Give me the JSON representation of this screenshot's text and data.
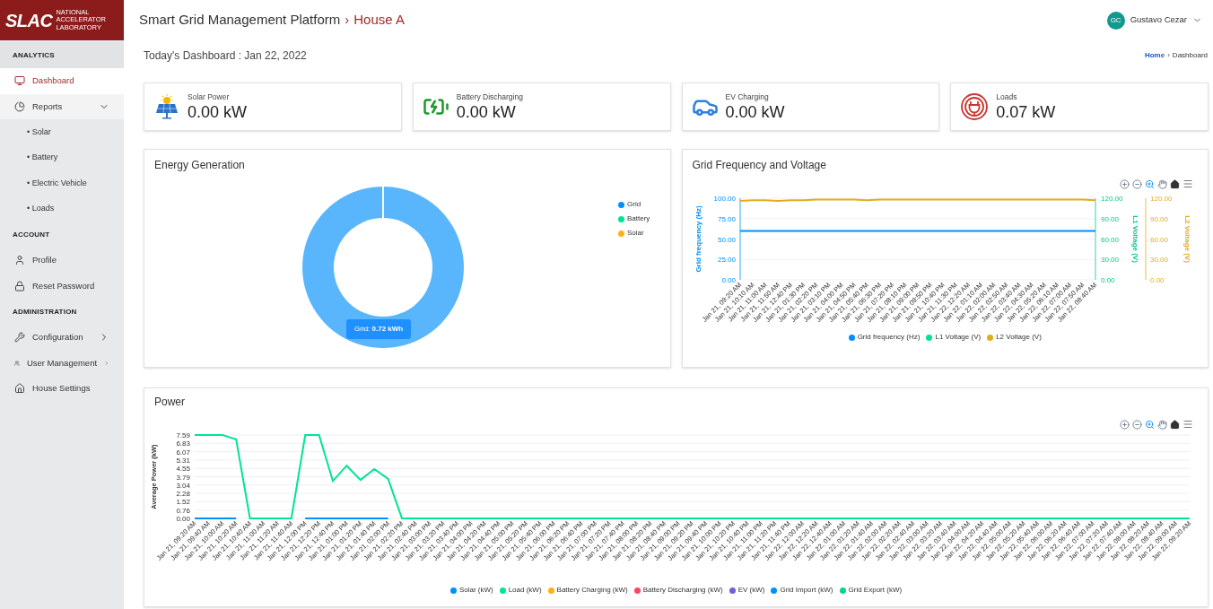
{
  "sidebar": {
    "logo": {
      "text": "SLAC",
      "lines": [
        "NATIONAL",
        "ACCELERATOR",
        "LABORATORY"
      ]
    },
    "sections": [
      {
        "title": "ANALYTICS",
        "items": [
          {
            "label": "Dashboard",
            "selected": true
          },
          {
            "label": "Reports",
            "selected": false,
            "expanded": true,
            "children": [
              {
                "label": "• Solar",
                "selected": false
              },
              {
                "label": "• Battery",
                "selected": false
              },
              {
                "label": "• Electric Vehicle",
                "selected": false
              },
              {
                "label": "• Loads",
                "selected": false
              }
            ]
          }
        ]
      },
      {
        "title": "ACCOUNT",
        "items": [
          {
            "label": "Profile",
            "selected": false
          },
          {
            "label": "Reset Password",
            "selected": false
          }
        ]
      },
      {
        "title": "ADMINISTRATION",
        "items": [
          {
            "label": "Configuration",
            "selected": false,
            "expanded": false
          },
          {
            "label": "User Management",
            "selected": false,
            "expanded": false
          },
          {
            "label": "House Settings",
            "selected": false
          }
        ]
      }
    ]
  },
  "header": {
    "title": "Smart Grid Management Platform",
    "separator": "›",
    "page": "House A",
    "user": {
      "initials": "GC",
      "name": "Gustavo Cezar"
    }
  },
  "subheader": {
    "title": "Today's Dashboard : Jan 22, 2022",
    "breadcrumb": [
      "Home",
      "›",
      "Dashboard"
    ]
  },
  "stats": [
    {
      "kind": "solar",
      "label": "Solar Power",
      "value": "0.00 kW"
    },
    {
      "kind": "battery",
      "label": "Battery Discharging",
      "value": "0.00 kW"
    },
    {
      "kind": "ev",
      "label": "EV Charging",
      "value": "0.00 kW"
    },
    {
      "kind": "loads",
      "label": "Loads",
      "value": "0.07 kW"
    }
  ],
  "energy_generation": {
    "title": "Energy Generation",
    "tooltip": "Grid:  **0.72 kWh**",
    "chart_data": {
      "type": "donut",
      "categories": [
        "Grid",
        "Battery",
        "Solar"
      ],
      "values": [
        100,
        0,
        0
      ],
      "colors": [
        "#008ffb",
        "#00e396",
        "#feb019"
      ]
    }
  },
  "grid_frequency": {
    "title": "Grid Frequency and Voltage",
    "chart_data": {
      "type": "line",
      "grid": true,
      "categories": [
        "Jan 21, 09:20 AM",
        "Jan 21, 10:10 AM",
        "Jan 21, 11:00 AM",
        "Jan 21, 11:50 AM",
        "Jan 21, 12:40 PM",
        "Jan 21, 01:30 PM",
        "Jan 21, 02:20 PM",
        "Jan 21, 03:10 PM",
        "Jan 21, 04:00 PM",
        "Jan 21, 04:50 PM",
        "Jan 21, 05:40 PM",
        "Jan 21, 06:30 PM",
        "Jan 21, 07:20 PM",
        "Jan 21, 08:10 PM",
        "Jan 21, 09:00 PM",
        "Jan 21, 09:50 PM",
        "Jan 21, 10:40 PM",
        "Jan 21, 11:30 PM",
        "Jan 22, 12:20 AM",
        "Jan 22, 01:10 AM",
        "Jan 22, 02:00 AM",
        "Jan 22, 02:50 AM",
        "Jan 22, 03:40 AM",
        "Jan 22, 04:30 AM",
        "Jan 22, 05:20 AM",
        "Jan 22, 06:10 AM",
        "Jan 22, 07:00 AM",
        "Jan 22, 07:50 AM",
        "Jan 22, 08:40 AM"
      ],
      "ylabel": "Grid frequency (Hz)",
      "ylim": [
        0,
        100
      ],
      "yticks": [
        {
          "value": 0,
          "label": "0.00"
        },
        {
          "value": 25,
          "label": "25.00"
        },
        {
          "value": 50,
          "label": "50.00"
        },
        {
          "value": 75,
          "label": "75.00"
        },
        {
          "value": 100,
          "label": "100.00"
        }
      ],
      "y2label": "L1 Voltage (V)",
      "y2lim": [
        0,
        120
      ],
      "y2ticks": [
        {
          "value": 0,
          "label": "0.00"
        },
        {
          "value": 30,
          "label": "30.00"
        },
        {
          "value": 60,
          "label": "60.00"
        },
        {
          "value": 90,
          "label": "90.00"
        },
        {
          "value": 120,
          "label": "120.00"
        }
      ],
      "y3label": "L2 Voltage (V)",
      "y3lim": [
        0,
        120
      ],
      "y3ticks": [
        {
          "value": 0,
          "label": "0.00"
        },
        {
          "value": 30,
          "label": "30.00"
        },
        {
          "value": 60,
          "label": "60.00"
        },
        {
          "value": 90,
          "label": "90.00"
        },
        {
          "value": 120,
          "label": "120.00"
        }
      ],
      "series": [
        {
          "name": "Grid frequency (Hz)",
          "color": "#008ffb",
          "axis": "y",
          "values": [
            60,
            60,
            60,
            60,
            60,
            60,
            60,
            60,
            60,
            60,
            60,
            60,
            60,
            60,
            60,
            60,
            60,
            60,
            60,
            60,
            60,
            60,
            60,
            60,
            60,
            60,
            60,
            60,
            60
          ]
        },
        {
          "name": "L1 Voltage (V)",
          "color": "#00e396",
          "axis": "y2",
          "values": [
            null,
            null,
            null,
            null,
            null,
            null,
            null,
            null,
            null,
            null,
            null,
            null,
            null,
            null,
            null,
            null,
            null,
            null,
            null,
            null,
            null,
            null,
            null,
            null,
            null,
            null,
            null,
            null,
            null
          ]
        },
        {
          "name": "L2 Voltage (V)",
          "color": "#e2ac1c",
          "axis": "y3",
          "values": [
            116,
            117,
            117,
            116,
            117,
            117,
            118,
            118,
            118,
            118,
            117,
            118,
            118,
            118,
            118,
            118,
            118,
            118,
            118,
            118,
            118,
            118,
            118,
            118,
            118,
            118,
            118,
            118,
            117
          ]
        }
      ]
    }
  },
  "power": {
    "title": "Power",
    "chart_data": {
      "type": "line",
      "grid": true,
      "ylabel": "Average Power (kW)",
      "ylim": [
        0,
        7.59
      ],
      "yticks": [
        {
          "value": 0,
          "label": "0.00"
        },
        {
          "value": 0.76,
          "label": "0.76"
        },
        {
          "value": 1.52,
          "label": "1.52"
        },
        {
          "value": 2.28,
          "label": "2.28"
        },
        {
          "value": 3.04,
          "label": "3.04"
        },
        {
          "value": 3.79,
          "label": "3.79"
        },
        {
          "value": 4.55,
          "label": "4.55"
        },
        {
          "value": 5.31,
          "label": "5.31"
        },
        {
          "value": 6.07,
          "label": "6.07"
        },
        {
          "value": 6.83,
          "label": "6.83"
        },
        {
          "value": 7.59,
          "label": "7.59"
        }
      ],
      "categories": [
        "Jan 21, 09:20 AM",
        "Jan 21, 09:40 AM",
        "Jan 21, 10:00 AM",
        "Jan 21, 10:20 AM",
        "Jan 21, 10:40 AM",
        "Jan 21, 11:00 AM",
        "Jan 21, 11:20 AM",
        "Jan 21, 11:40 AM",
        "Jan 21, 12:00 PM",
        "Jan 21, 12:20 PM",
        "Jan 21, 12:40 PM",
        "Jan 21, 01:00 PM",
        "Jan 21, 01:20 PM",
        "Jan 21, 01:40 PM",
        "Jan 21, 02:00 PM",
        "Jan 21, 02:20 PM",
        "Jan 21, 02:40 PM",
        "Jan 21, 03:00 PM",
        "Jan 21, 03:20 PM",
        "Jan 21, 03:40 PM",
        "Jan 21, 04:00 PM",
        "Jan 21, 04:20 PM",
        "Jan 21, 04:40 PM",
        "Jan 21, 05:00 PM",
        "Jan 21, 05:20 PM",
        "Jan 21, 05:40 PM",
        "Jan 21, 06:00 PM",
        "Jan 21, 06:20 PM",
        "Jan 21, 06:40 PM",
        "Jan 21, 07:00 PM",
        "Jan 21, 07:20 PM",
        "Jan 21, 07:40 PM",
        "Jan 21, 08:00 PM",
        "Jan 21, 08:20 PM",
        "Jan 21, 08:40 PM",
        "Jan 21, 09:00 PM",
        "Jan 21, 09:20 PM",
        "Jan 21, 09:40 PM",
        "Jan 21, 10:00 PM",
        "Jan 21, 10:20 PM",
        "Jan 21, 10:40 PM",
        "Jan 21, 11:00 PM",
        "Jan 21, 11:20 PM",
        "Jan 21, 11:40 PM",
        "Jan 22, 12:00 AM",
        "Jan 22, 12:20 AM",
        "Jan 22, 12:40 AM",
        "Jan 22, 01:00 AM",
        "Jan 22, 01:20 AM",
        "Jan 22, 01:40 AM",
        "Jan 22, 02:00 AM",
        "Jan 22, 02:20 AM",
        "Jan 22, 02:40 AM",
        "Jan 22, 03:00 AM",
        "Jan 22, 03:20 AM",
        "Jan 22, 03:40 AM",
        "Jan 22, 04:00 AM",
        "Jan 22, 04:20 AM",
        "Jan 22, 04:40 AM",
        "Jan 22, 05:00 AM",
        "Jan 22, 05:20 AM",
        "Jan 22, 05:40 AM",
        "Jan 22, 06:00 AM",
        "Jan 22, 06:20 AM",
        "Jan 22, 06:40 AM",
        "Jan 22, 07:00 AM",
        "Jan 22, 07:20 AM",
        "Jan 22, 07:40 AM",
        "Jan 22, 08:00 AM",
        "Jan 22, 08:20 AM",
        "Jan 22, 08:40 AM",
        "Jan 22, 09:00 AM",
        "Jan 22, 09:20 AM"
      ],
      "series": [
        {
          "name": "Solar (kW)",
          "color": "#008ffb",
          "values": [
            0,
            0,
            0,
            0,
            null,
            null,
            null,
            null,
            0,
            0,
            0,
            0,
            0,
            0,
            0,
            null,
            null,
            null,
            null,
            null,
            null,
            null,
            null,
            null,
            null,
            null,
            null,
            null,
            null,
            null,
            null,
            null,
            null,
            null,
            null,
            null,
            null,
            null,
            null,
            null,
            null,
            null,
            null,
            null,
            null,
            null,
            null,
            null,
            null,
            null,
            null,
            null,
            null,
            null,
            null,
            null,
            null,
            null,
            null,
            null,
            null,
            null,
            null,
            null,
            null,
            null,
            null,
            null,
            null,
            null,
            null,
            null,
            null
          ]
        },
        {
          "name": "Load (kW)",
          "color": "#00e396",
          "values": [
            7.59,
            7.59,
            7.59,
            7.2,
            0,
            0,
            0,
            0,
            7.59,
            7.59,
            3.4,
            4.8,
            3.5,
            4.5,
            3.6,
            0,
            0,
            0,
            0,
            0,
            0,
            0,
            0,
            0,
            0,
            0,
            0,
            0,
            0,
            0,
            0,
            0,
            0,
            0,
            0,
            0,
            0,
            0,
            0,
            0,
            0,
            0,
            0,
            0,
            0,
            0,
            0,
            0,
            0,
            0,
            0,
            0,
            0,
            0,
            0,
            0,
            0,
            0,
            0,
            0,
            0,
            0,
            0,
            0,
            0,
            0,
            0,
            0,
            0,
            0,
            0,
            0,
            0
          ]
        },
        {
          "name": "Battery Charging (kW)",
          "color": "#feb019",
          "values": [
            null,
            null,
            null,
            null,
            null,
            null,
            null,
            null,
            null,
            null,
            null,
            null,
            null,
            null,
            null,
            null,
            null,
            null,
            null,
            null,
            null,
            null,
            null,
            null,
            null,
            null,
            null,
            null,
            null,
            null,
            null,
            null,
            null,
            null,
            null,
            null,
            null,
            null,
            null,
            null,
            null,
            null,
            null,
            null,
            null,
            null,
            null,
            null,
            null,
            null,
            null,
            null,
            null,
            null,
            null,
            null,
            null,
            null,
            null,
            null,
            null,
            null,
            null,
            null,
            null,
            null,
            null,
            null,
            null,
            null,
            null,
            null,
            null
          ]
        },
        {
          "name": "Battery Discharging (kW)",
          "color": "#ff4560",
          "values": [
            null,
            null,
            null,
            null,
            null,
            null,
            null,
            null,
            null,
            null,
            null,
            null,
            null,
            null,
            null,
            null,
            null,
            null,
            null,
            null,
            null,
            null,
            null,
            null,
            null,
            null,
            null,
            null,
            null,
            null,
            null,
            null,
            null,
            null,
            null,
            null,
            null,
            null,
            null,
            null,
            null,
            null,
            null,
            null,
            null,
            null,
            null,
            null,
            null,
            null,
            null,
            null,
            null,
            null,
            null,
            null,
            null,
            null,
            null,
            null,
            null,
            null,
            null,
            null,
            null,
            null,
            null,
            null,
            null,
            null,
            null,
            null,
            null
          ]
        },
        {
          "name": "EV (kW)",
          "color": "#775dd0",
          "values": [
            null,
            null,
            null,
            null,
            null,
            null,
            null,
            null,
            null,
            null,
            null,
            null,
            null,
            null,
            null,
            null,
            null,
            null,
            null,
            null,
            null,
            null,
            null,
            null,
            null,
            null,
            null,
            null,
            null,
            null,
            null,
            null,
            null,
            null,
            null,
            null,
            null,
            null,
            null,
            null,
            null,
            null,
            null,
            null,
            null,
            null,
            null,
            null,
            null,
            null,
            null,
            null,
            null,
            null,
            null,
            null,
            null,
            null,
            null,
            null,
            null,
            null,
            null,
            null,
            null,
            null,
            null,
            null,
            null,
            null,
            null,
            null,
            null
          ]
        },
        {
          "name": "Grid Import (kW)",
          "color": "#008ffb",
          "values": [
            null,
            null,
            null,
            null,
            null,
            null,
            null,
            null,
            null,
            null,
            null,
            null,
            null,
            null,
            null,
            null,
            null,
            null,
            null,
            null,
            null,
            null,
            null,
            null,
            null,
            null,
            null,
            null,
            null,
            null,
            null,
            null,
            null,
            null,
            null,
            null,
            null,
            null,
            null,
            null,
            null,
            null,
            null,
            null,
            null,
            null,
            null,
            null,
            null,
            null,
            null,
            null,
            null,
            null,
            null,
            null,
            null,
            null,
            null,
            null,
            null,
            null,
            null,
            null,
            null,
            null,
            null,
            null,
            null,
            null,
            null,
            null,
            null
          ]
        },
        {
          "name": "Grid Export (kW)",
          "color": "#00d68f",
          "values": [
            null,
            null,
            null,
            null,
            null,
            null,
            null,
            null,
            null,
            null,
            null,
            null,
            null,
            null,
            null,
            null,
            null,
            null,
            null,
            null,
            null,
            null,
            null,
            null,
            null,
            null,
            null,
            null,
            null,
            null,
            null,
            null,
            null,
            null,
            null,
            null,
            null,
            null,
            null,
            null,
            null,
            null,
            null,
            null,
            null,
            null,
            null,
            null,
            null,
            null,
            null,
            null,
            null,
            null,
            null,
            null,
            null,
            null,
            null,
            null,
            null,
            null,
            null,
            null,
            null,
            null,
            null,
            null,
            null,
            null,
            null,
            null,
            null
          ]
        }
      ]
    }
  }
}
